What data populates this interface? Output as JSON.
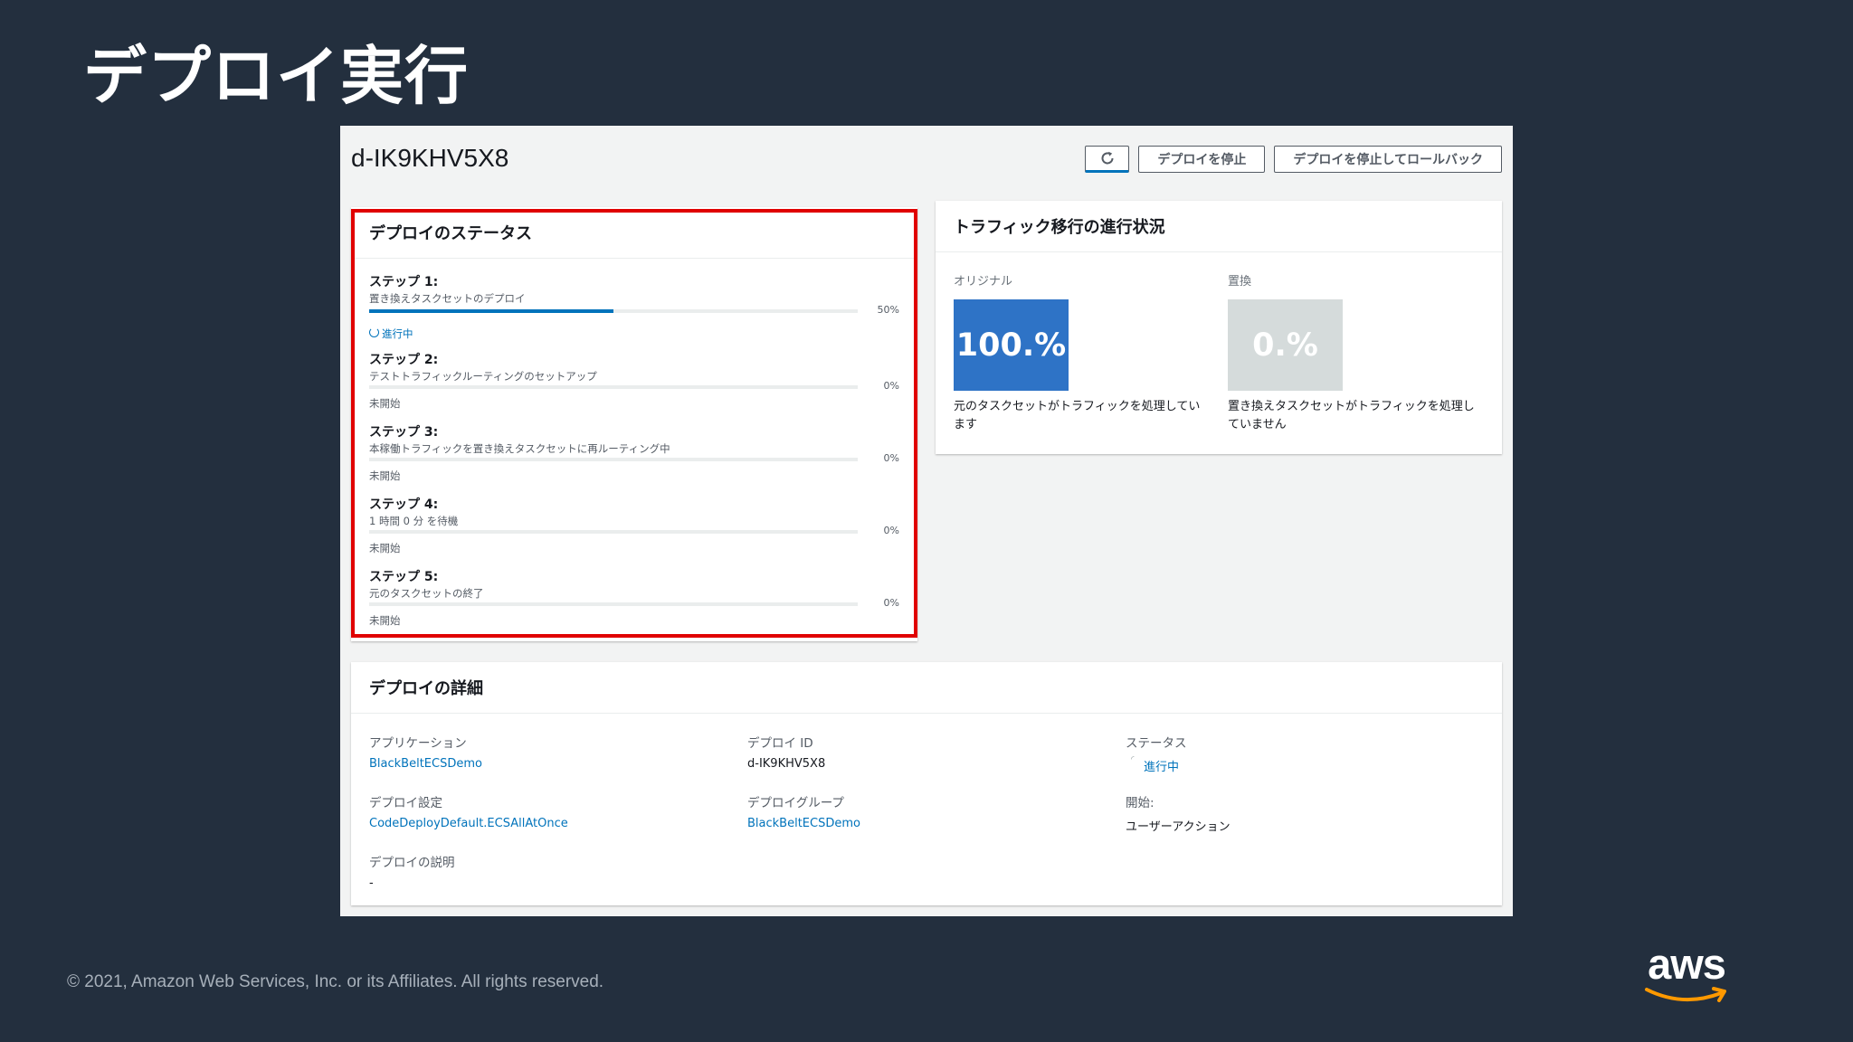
{
  "slide": {
    "title": "デプロイ実行",
    "copyright": "© 2021, Amazon Web Services, Inc. or its Affiliates. All rights reserved.",
    "logo_text": "aws",
    "highlight_color": "#e00000"
  },
  "deployment": {
    "id": "d-IK9KHV5X8",
    "buttons": {
      "refresh_icon": "refresh-icon",
      "stop": "デプロイを停止",
      "stop_rollback": "デプロイを停止してロールバック"
    }
  },
  "status_panel": {
    "title": "デプロイのステータス",
    "steps": [
      {
        "title": "ステップ 1:",
        "desc": "置き換えタスクセットのデプロイ",
        "progress_pct": "50%",
        "progress": 0.5,
        "state": "進行中"
      },
      {
        "title": "ステップ 2:",
        "desc": "テストトラフィックルーティングのセットアップ",
        "progress_pct": "0%",
        "progress": 0,
        "state": "未開始"
      },
      {
        "title": "ステップ 3:",
        "desc": "本稼働トラフィックを置き換えタスクセットに再ルーティング中",
        "progress_pct": "0%",
        "progress": 0,
        "state": "未開始"
      },
      {
        "title": "ステップ 4:",
        "desc": "1 時間 0 分 を待機",
        "progress_pct": "0%",
        "progress": 0,
        "state": "未開始"
      },
      {
        "title": "ステップ 5:",
        "desc": "元のタスクセットの終了",
        "progress_pct": "0%",
        "progress": 0,
        "state": "未開始"
      }
    ]
  },
  "traffic_panel": {
    "title": "トラフィック移行の進行状況",
    "original": {
      "label": "オリジナル",
      "value": "100.%",
      "caption": "元のタスクセットがトラフィックを処理しています",
      "color": "#2e73c6"
    },
    "replacement": {
      "label": "置換",
      "value": "0.%",
      "caption": "置き換えタスクセットがトラフィックを処理していません",
      "color": "#d5dbdb"
    }
  },
  "details_panel": {
    "title": "デプロイの詳細",
    "application": {
      "label": "アプリケーション",
      "value": "BlackBeltECSDemo"
    },
    "deploy_id": {
      "label": "デプロイ ID",
      "value": "d-IK9KHV5X8"
    },
    "status": {
      "label": "ステータス",
      "value": "進行中"
    },
    "deploy_config": {
      "label": "デプロイ設定",
      "value": "CodeDeployDefault.ECSAllAtOnce"
    },
    "deploy_group": {
      "label": "デプロイグループ",
      "value": "BlackBeltECSDemo"
    },
    "start": {
      "label": "開始:",
      "value": "ユーザーアクション"
    },
    "description": {
      "label": "デプロイの説明",
      "value": "-"
    }
  }
}
